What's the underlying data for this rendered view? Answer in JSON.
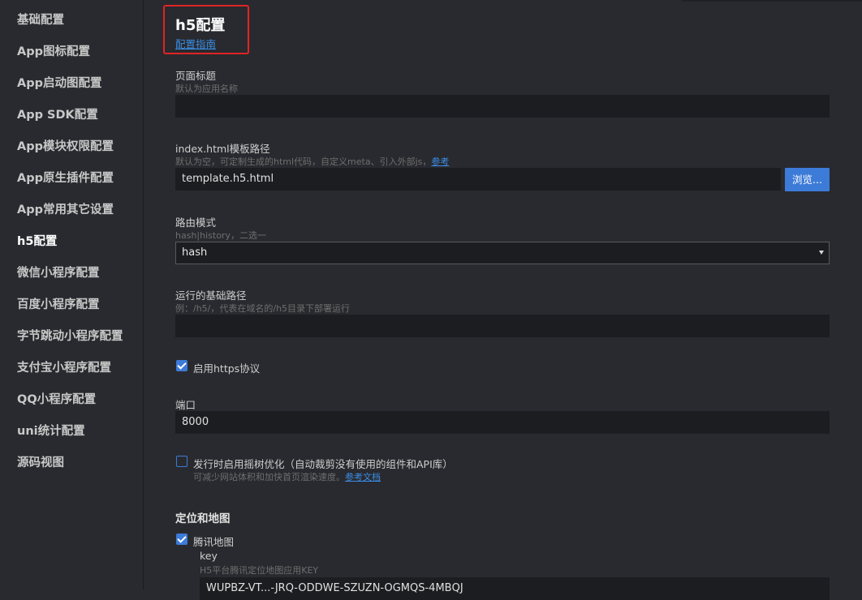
{
  "sidebar": {
    "items": [
      {
        "label": "基础配置",
        "active": false
      },
      {
        "label": "App图标配置",
        "active": false
      },
      {
        "label": "App启动图配置",
        "active": false
      },
      {
        "label": "App SDK配置",
        "active": false
      },
      {
        "label": "App模块权限配置",
        "active": false
      },
      {
        "label": "App原生插件配置",
        "active": false
      },
      {
        "label": "App常用其它设置",
        "active": false
      },
      {
        "label": "h5配置",
        "active": true
      },
      {
        "label": "微信小程序配置",
        "active": false
      },
      {
        "label": "百度小程序配置",
        "active": false
      },
      {
        "label": "字节跳动小程序配置",
        "active": false
      },
      {
        "label": "支付宝小程序配置",
        "active": false
      },
      {
        "label": "QQ小程序配置",
        "active": false
      },
      {
        "label": "uni统计配置",
        "active": false
      },
      {
        "label": "源码视图",
        "active": false
      }
    ]
  },
  "header": {
    "title": "h5配置",
    "guide_link": "配置指南"
  },
  "form": {
    "page_title": {
      "label": "页面标题",
      "hint": "默认为应用名称",
      "value": ""
    },
    "template": {
      "label": "index.html模板路径",
      "hint": "默认为空，可定制生成的html代码，自定义meta、引入外部js，",
      "hint_link": "参考",
      "value": "template.h5.html",
      "browse_label": "浏览..."
    },
    "router_mode": {
      "label": "路由模式",
      "hint": "hash|history，二选一",
      "selected": "hash"
    },
    "base_path": {
      "label": "运行的基础路径",
      "hint": "例：/h5/，代表在域名的/h5目录下部署运行",
      "value": ""
    },
    "https": {
      "label": "启用https协议",
      "checked": true
    },
    "port": {
      "label": "端口",
      "value": "8000"
    },
    "treeshaking": {
      "label": "发行时启用摇树优化（自动裁剪没有使用的组件和API库）",
      "hint": "可减少网站体积和加快首页渲染速度。",
      "hint_link": "参考文档",
      "checked": false
    }
  },
  "location_map": {
    "section_title": "定位和地图",
    "tencent_map": {
      "label": "腾讯地图",
      "checked": true,
      "key_label": "key",
      "key_hint": "H5平台腾讯定位地图应用KEY",
      "key_value": "WUPBZ-VT...-JRQ-ODDWE-SZUZN-OGMQS-4MBQJ"
    }
  },
  "colors": {
    "background": "#292a2f",
    "input_bg": "#1c1d21",
    "accent": "#3d7bd8",
    "link": "#3a8ee6",
    "highlight_border": "#e02424"
  }
}
